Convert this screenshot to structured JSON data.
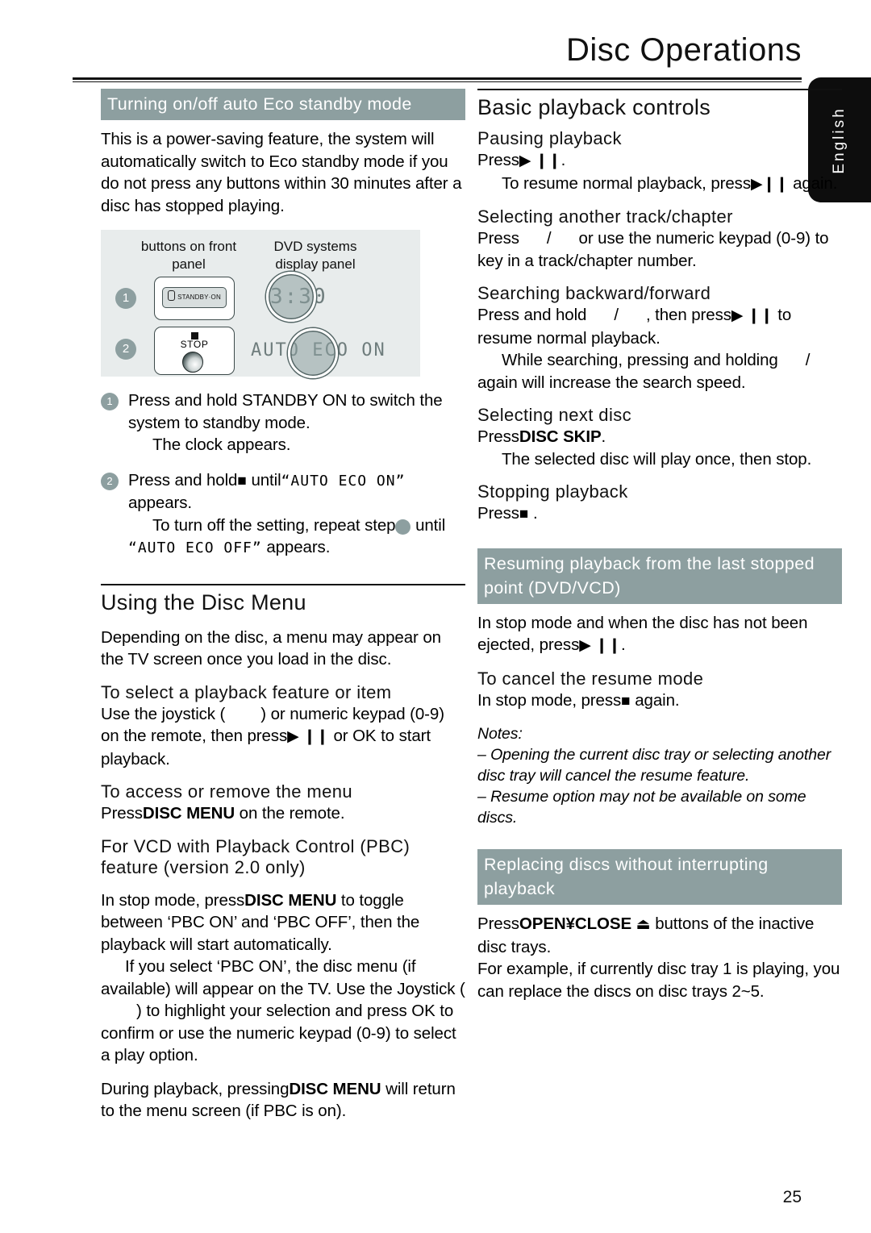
{
  "page": {
    "title": "Disc Operations",
    "number": "25",
    "language_tab": "English"
  },
  "left_column": {
    "eco_heading": "Turning on/off auto Eco standby mode",
    "eco_intro": "This is a power-saving feature, the system will automatically switch to Eco standby mode if you do not press any buttons within 30 minutes after a disc has stopped playing.",
    "diagram": {
      "label_left": "buttons on front panel",
      "label_right": "DVD systems display panel",
      "marker_1": "1",
      "marker_2": "2",
      "standby_button_label": "STANDBY·ON",
      "stop_button_label": "STOP",
      "display_clock": "3:30",
      "display_eco": "AUTO ECO ON"
    },
    "step1_text": "Press and hold STANDBY ON to switch the system to standby mode.",
    "step1_note": "The clock appears.",
    "step2_prefix": "Press and hold",
    "step2_stop_icon": "■",
    "step2_mid": "until",
    "step2_lcd": "“AUTO ECO ON”",
    "step2_suffix": "appears.",
    "step2_note_a": "To turn off the setting, repeat step",
    "step2_note_num": "2",
    "step2_note_b": "until",
    "step2_note_lcd": "“AUTO ECO OFF”",
    "step2_note_c": "appears.",
    "disc_menu_heading": "Using the Disc Menu",
    "disc_menu_intro": "Depending on the disc, a menu may appear on the TV screen once you load in the disc.",
    "select_feature_heading": "To select a playback feature or item",
    "select_feature_body_a": "Use the joystick (",
    "select_feature_body_b": ") or numeric keypad (0-9) on the remote, then press",
    "select_feature_icon": "▶ ❙❙",
    "select_feature_body_c": "or OK to start playback.",
    "access_menu_heading": "To access or remove the menu",
    "access_menu_body_a": "Press",
    "access_menu_bold": "DISC MENU",
    "access_menu_body_b": "on the remote.",
    "pbc_heading": "For VCD with Playback Control (PBC) feature (version 2.0 only)",
    "pbc_para1_a": "In stop mode, press",
    "pbc_para1_bold": "DISC MENU",
    "pbc_para1_b": "to toggle between ‘PBC ON’ and ‘PBC OFF’, then the playback will start automatically.",
    "pbc_para2_a": "If you select ‘PBC ON’, the disc menu (if available) will appear on the TV.  Use the Joystick (",
    "pbc_para2_b": ") to highlight your selection and press OK to confirm or use the numeric keypad (0-9) to select a play option.",
    "pbc_para3_a": "During playback, pressing",
    "pbc_para3_bold": "DISC MENU",
    "pbc_para3_b": "will return to the menu screen (if PBC is on)."
  },
  "right_column": {
    "basic_heading": "Basic playback controls",
    "pausing_heading": "Pausing playback",
    "pausing_press": "Press",
    "pausing_icon": "▶ ❙❙",
    "pausing_period": ".",
    "pausing_note_a": "To resume normal playback, press",
    "pausing_note_icon": "▶❙❙",
    "pausing_note_b": "again.",
    "track_heading": "Selecting another track/chapter",
    "track_body_a": "Press",
    "track_slash": "/",
    "track_body_b": "or use the numeric keypad (0-9) to key in a track/chapter number.",
    "search_heading": "Searching backward/forward",
    "search_body_a": "Press and hold",
    "search_slash": "/",
    "search_body_b": ", then press",
    "search_icon": "▶ ❙❙",
    "search_body_c": "to resume normal playback.",
    "search_note_a": "While searching, pressing and holding",
    "search_note_slash": "/",
    "search_note_b": "again will increase the search speed.",
    "next_disc_heading": "Selecting next disc",
    "next_disc_press": "Press",
    "next_disc_bold": "DISC SKIP",
    "next_disc_period": ".",
    "next_disc_note": "The selected disc will play once, then stop.",
    "stopping_heading": "Stopping playback",
    "stopping_press": "Press",
    "stopping_icon": "■",
    "stopping_period": ".",
    "resume_heading": "Resuming playback from the last stopped point (DVD/VCD)",
    "resume_body_a": "In stop mode and when the disc has not been ejected, press",
    "resume_icon": "▶ ❙❙",
    "resume_period": ".",
    "cancel_resume_heading": "To cancel the resume mode",
    "cancel_resume_a": "In stop mode, press",
    "cancel_resume_icon": "■",
    "cancel_resume_b": "again.",
    "notes_label": "Notes:",
    "note_1": "–  Opening the current disc tray or selecting another disc tray will cancel the resume feature.",
    "note_2": "–  Resume option may not be available on some discs.",
    "replacing_heading": "Replacing discs without interrupting playback",
    "replacing_a": "Press",
    "replacing_bold": "OPEN¥CLOSE",
    "replacing_eject_icon": "⏏",
    "replacing_b": "buttons of the inactive disc trays.",
    "replacing_c": "For example, if currently disc tray 1 is playing, you can replace the discs on disc trays 2~5."
  },
  "colors": {
    "heading_highlight": "#8d9fa0",
    "tab_background": "#0d0d0d",
    "diagram_background": "#e8ecec",
    "lcd_text": "#6f7d7d"
  }
}
